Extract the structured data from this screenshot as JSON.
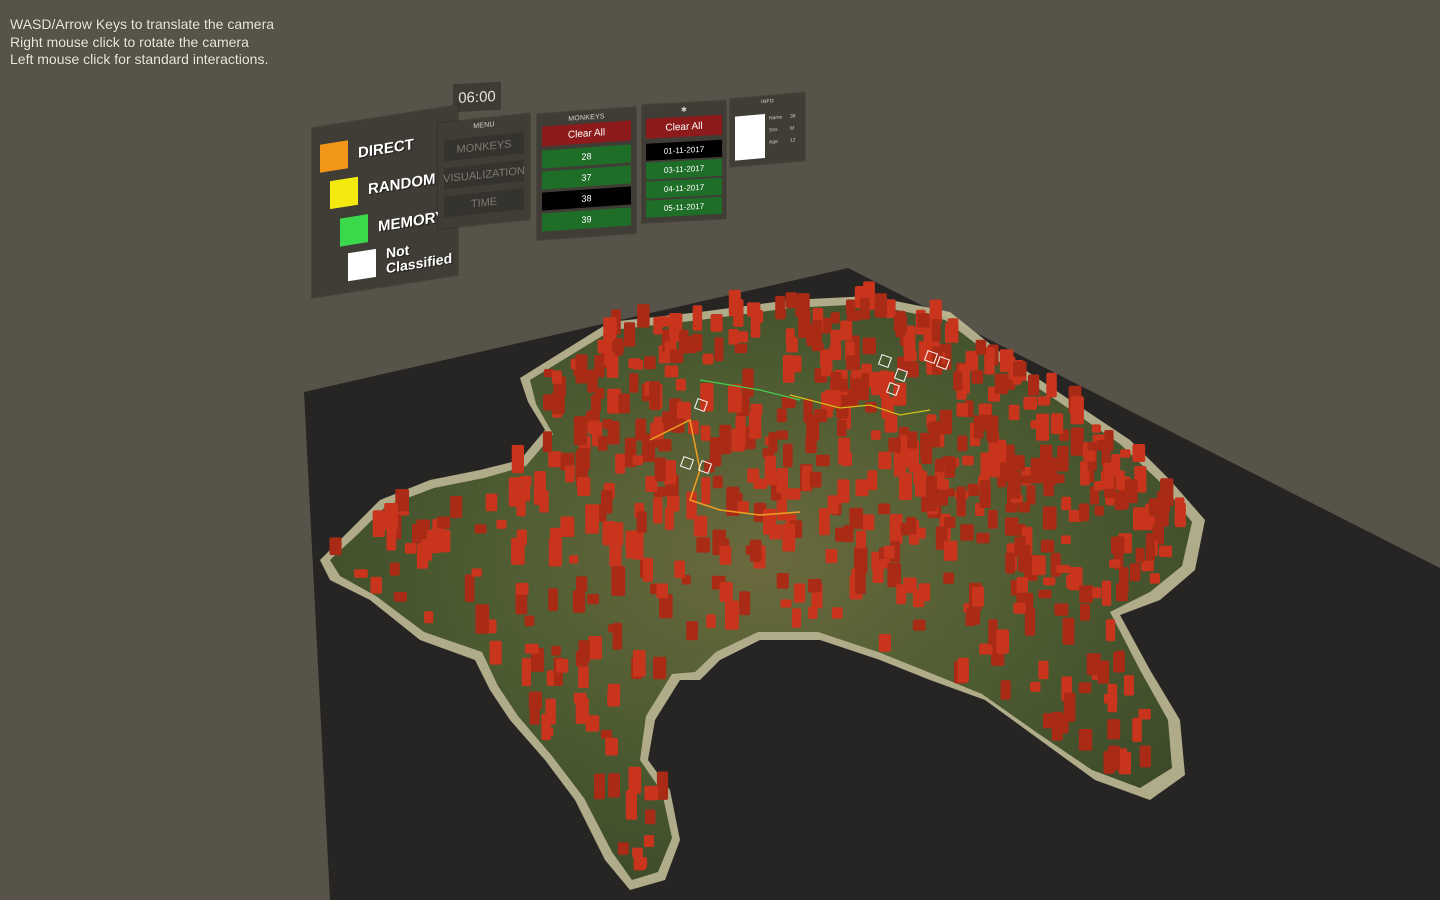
{
  "instructions": [
    "WASD/Arrow Keys to translate the camera",
    "Right mouse click to rotate the camera",
    "Left mouse click for standard interactions."
  ],
  "clock": "06:00",
  "legend": [
    {
      "label": "DIRECT",
      "color": "#f2961a"
    },
    {
      "label": "RANDOM",
      "color": "#f4ea10"
    },
    {
      "label": "MEMORY",
      "color": "#3ad94b"
    },
    {
      "label": "Not Classified",
      "color": "#ffffff"
    }
  ],
  "menu": {
    "title": "MENU",
    "items": [
      "MONKEYS",
      "VISUALIZATION",
      "TIME"
    ]
  },
  "monkeys": {
    "title": "MONKEYS",
    "clear_label": "Clear All",
    "items": [
      {
        "label": "28",
        "selected": false
      },
      {
        "label": "37",
        "selected": false
      },
      {
        "label": "38",
        "selected": true
      },
      {
        "label": "39",
        "selected": false
      }
    ]
  },
  "dates": {
    "title": "✱",
    "clear_label": "Clear All",
    "items": [
      {
        "label": "01-11-2017",
        "selected": true
      },
      {
        "label": "03-11-2017",
        "selected": false
      },
      {
        "label": "04-11-2017",
        "selected": false
      },
      {
        "label": "05-11-2017",
        "selected": false
      }
    ]
  },
  "info": {
    "title": "INFO",
    "rows": [
      {
        "key": "Name",
        "value": "38"
      },
      {
        "key": "Sex",
        "value": "M"
      },
      {
        "key": "Age",
        "value": "12"
      }
    ]
  },
  "colors": {
    "background": "#575349",
    "ground": "#262523",
    "island": "#4f5d34",
    "tree": "#c8351c",
    "shore": "#dcd1a4"
  }
}
